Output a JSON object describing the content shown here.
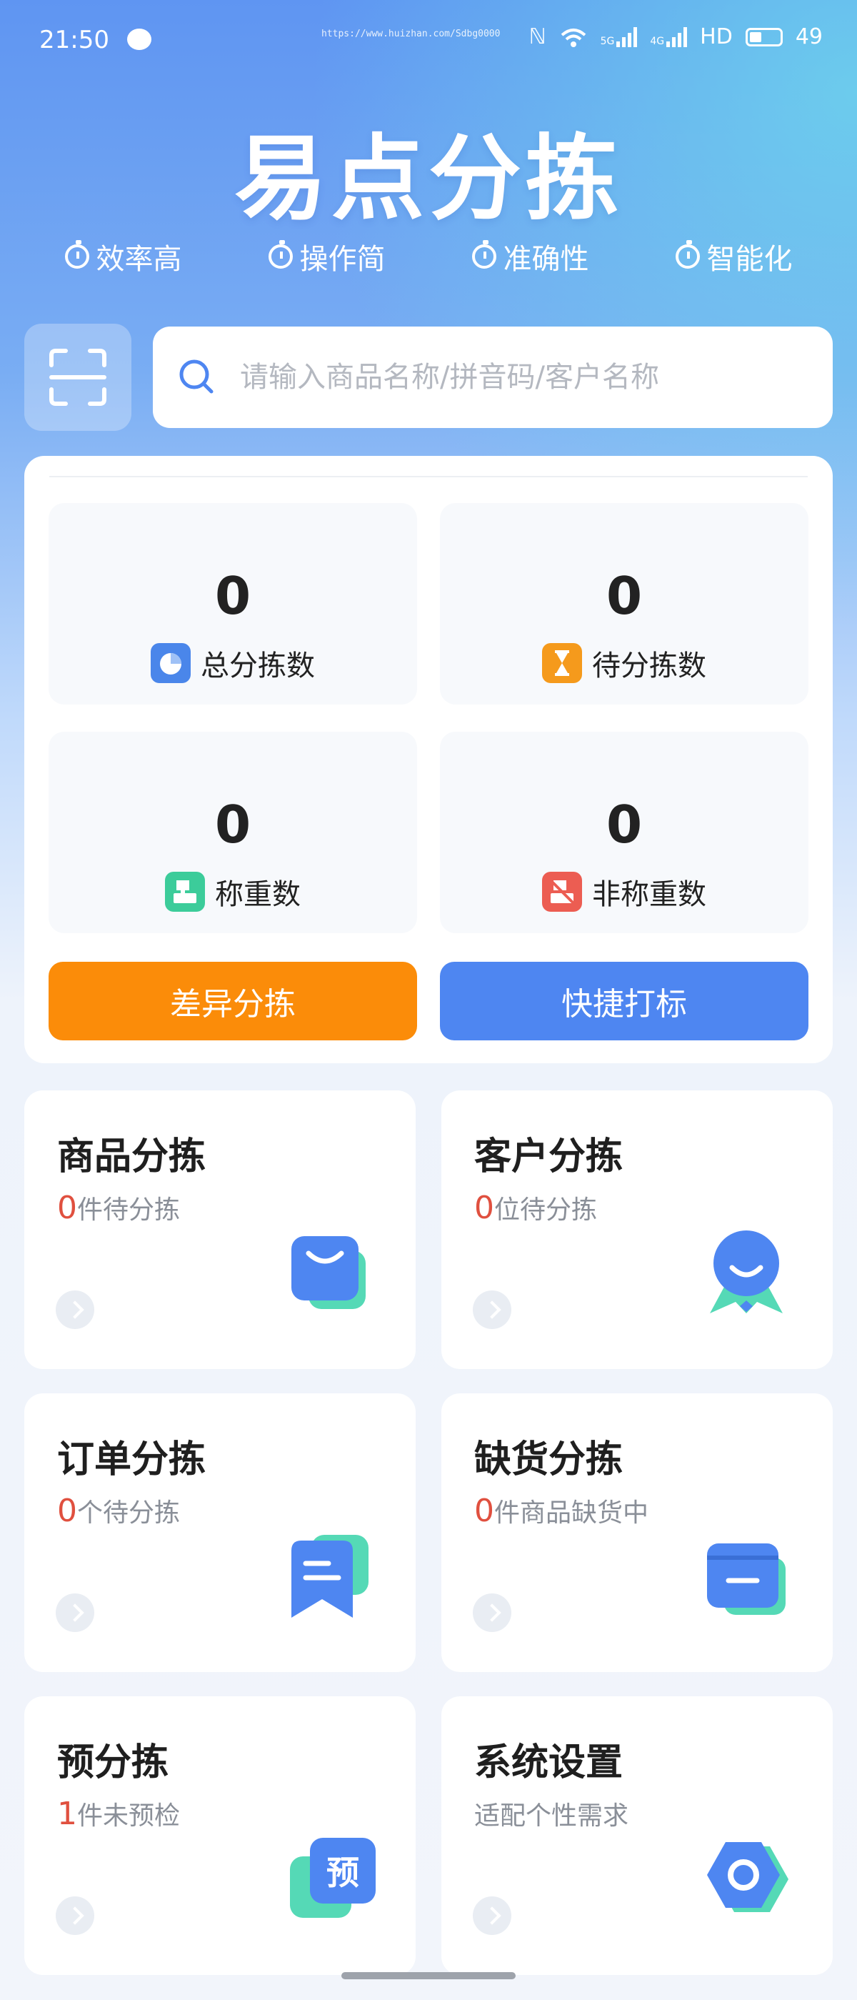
{
  "status_bar": {
    "time": "21:50",
    "url": "https://www.huizhan.com/Sdbg0000",
    "network_5g": "5G",
    "network_4g": "4G",
    "hd": "HD",
    "battery": "49"
  },
  "app": {
    "logo_text": "易点分拣",
    "features": [
      "效率高",
      "操作简",
      "准确性",
      "智能化"
    ]
  },
  "search": {
    "placeholder": "请输入商品名称/拼音码/客户名称"
  },
  "stats": {
    "items": [
      {
        "value": "0",
        "label": "总分拣数",
        "color": "#4a86ea"
      },
      {
        "value": "0",
        "label": "待分拣数",
        "color": "#f59a1c"
      },
      {
        "value": "0",
        "label": "称重数",
        "color": "#3ccc9a"
      },
      {
        "value": "0",
        "label": "非称重数",
        "color": "#ec5d52"
      }
    ],
    "diff_button": "差异分拣",
    "quick_button": "快捷打标"
  },
  "modules": [
    {
      "title": "商品分拣",
      "count": "0",
      "suffix": "件待分拣",
      "icon": "shopping-bag-icon"
    },
    {
      "title": "客户分拣",
      "count": "0",
      "suffix": "位待分拣",
      "icon": "customer-icon"
    },
    {
      "title": "订单分拣",
      "count": "0",
      "suffix": "个待分拣",
      "icon": "order-icon"
    },
    {
      "title": "缺货分拣",
      "count": "0",
      "suffix": "件商品缺货中",
      "icon": "box-icon"
    },
    {
      "title": "预分拣",
      "count": "1",
      "suffix": "件未预检",
      "icon": "pre-sort-icon",
      "icon_text": "预"
    },
    {
      "title": "系统设置",
      "count": "",
      "suffix": "适配个性需求",
      "icon": "settings-icon"
    }
  ],
  "colors": {
    "primary": "#4e86f1",
    "orange": "#fb8c09",
    "teal": "#4bd6b1",
    "red_count": "#e0503f"
  }
}
